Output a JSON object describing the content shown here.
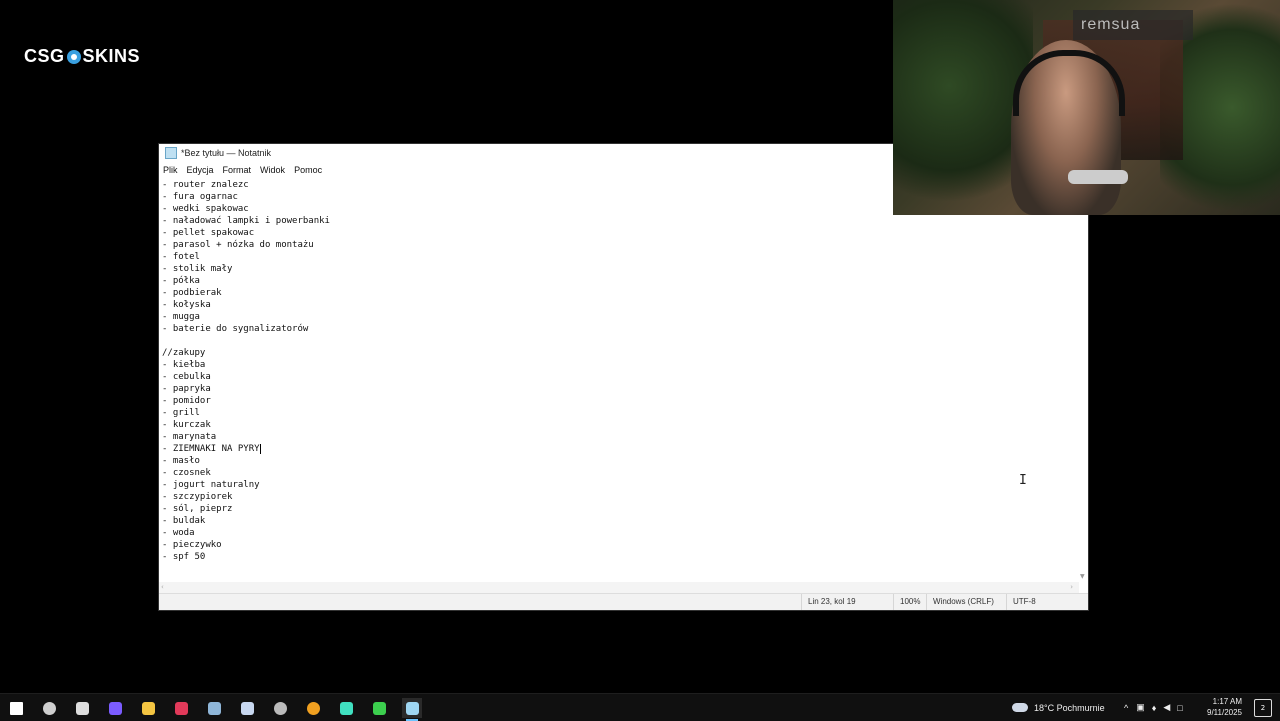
{
  "logo": {
    "text_left": "CSG",
    "text_right": "SKINS"
  },
  "notepad": {
    "title": "*Bez tytułu — Notatnik",
    "menu": [
      "Plik",
      "Edycja",
      "Format",
      "Widok",
      "Pomoc"
    ],
    "lines": [
      "- router znalezc",
      "- fura ogarnac",
      "- wedki spakowac",
      "- naładować lampki i powerbanki",
      "- pellet spakowac",
      "- parasol + nózka do montażu",
      "- fotel",
      "- stolik mały",
      "- półka",
      "- podbierak",
      "- kołyska",
      "- mugga",
      "- baterie do sygnalizatorów",
      "",
      "//zakupy",
      "- kiełba",
      "- cebulka",
      "- papryka",
      "- pomidor",
      "- grill",
      "- kurczak",
      "- marynata",
      "- ZIEMNAKI NA PYRY",
      "- masło",
      "- czosnek",
      "- jogurt naturalny",
      "- szczypiorek",
      "- sól, pieprz",
      "- buldak",
      "- woda",
      "- pieczywko",
      "- spf 50"
    ],
    "caret_line": 22,
    "status": {
      "position": "Lin 23, kol 19",
      "zoom": "100%",
      "line_ending": "Windows (CRLF)",
      "encoding": "UTF-8"
    }
  },
  "webcam": {
    "sign_text": "remsua"
  },
  "taskbar": {
    "apps": [
      {
        "name": "start-button",
        "color": "#ffffff"
      },
      {
        "name": "cortana-icon",
        "color": "#cfcfcf"
      },
      {
        "name": "terminal-icon",
        "color": "#dddddd"
      },
      {
        "name": "app-purple-icon",
        "color": "#7b5cff"
      },
      {
        "name": "file-explorer-icon",
        "color": "#f4c542"
      },
      {
        "name": "app-red-icon",
        "color": "#e23a5a"
      },
      {
        "name": "steam-icon",
        "color": "#8fb6d8"
      },
      {
        "name": "calendar-icon",
        "color": "#c8d8f0"
      },
      {
        "name": "app-circle-icon",
        "color": "#bbbbbb"
      },
      {
        "name": "chrome-icon",
        "color": "#f0a020"
      },
      {
        "name": "app-wave-icon",
        "color": "#40e0c0"
      },
      {
        "name": "app-green-icon",
        "color": "#3ccf4e"
      },
      {
        "name": "notepad-icon",
        "color": "#9fd6f2"
      }
    ],
    "weather": "18°C  Pochmurnie",
    "time": "1:17 AM",
    "date": "9/11/2025",
    "notifications": "2"
  }
}
